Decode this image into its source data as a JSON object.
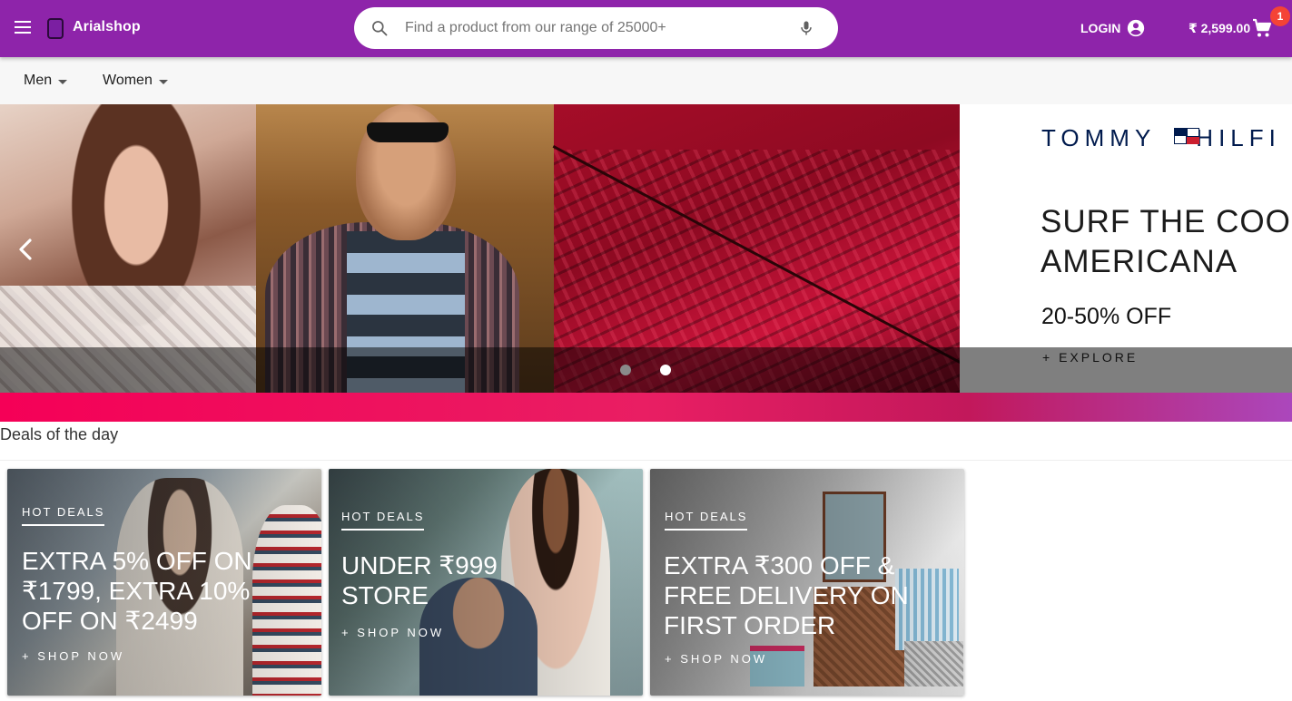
{
  "app": {
    "brand": "Arialshop"
  },
  "search": {
    "placeholder": "Find a product from our range of 25000+"
  },
  "header": {
    "login_label": "LOGIN",
    "cart_total": "₹ 2,599.00",
    "cart_count": "1"
  },
  "nav": {
    "categories": [
      {
        "label": "Men"
      },
      {
        "label": "Women"
      }
    ]
  },
  "hero": {
    "brand_left": "TOMMY",
    "brand_right": "HILFI",
    "headline_line1": "SURF THE COO",
    "headline_line2": "AMERICANA",
    "discount": "20-50% OFF",
    "cta": "+ EXPLORE",
    "slide_count": 2,
    "active_slide": 2
  },
  "deals": {
    "section_title": "Deals of the day",
    "cards": [
      {
        "tag": "HOT DEALS",
        "title_lines": [
          "EXTRA 5% OFF ON",
          "₹1799, EXTRA 10%",
          "OFF ON ₹2499"
        ],
        "cta": "+ SHOP NOW"
      },
      {
        "tag": "HOT DEALS",
        "title_lines": [
          "UNDER ₹999",
          "STORE"
        ],
        "cta": "+ SHOP NOW"
      },
      {
        "tag": "HOT DEALS",
        "title_lines": [
          "EXTRA ₹300 OFF &",
          "FREE DELIVERY ON",
          "FIRST ORDER"
        ],
        "cta": "+ SHOP NOW"
      }
    ]
  },
  "colors": {
    "appbar": "#8e24aa",
    "badge": "#f44336",
    "band_start": "#f50057",
    "band_end": "#ab47bc"
  },
  "icons": [
    "menu-icon",
    "brand-logo-icon",
    "search-icon",
    "mic-icon",
    "account-circle-icon",
    "cart-icon",
    "chevron-left-icon",
    "caret-down-icon"
  ]
}
